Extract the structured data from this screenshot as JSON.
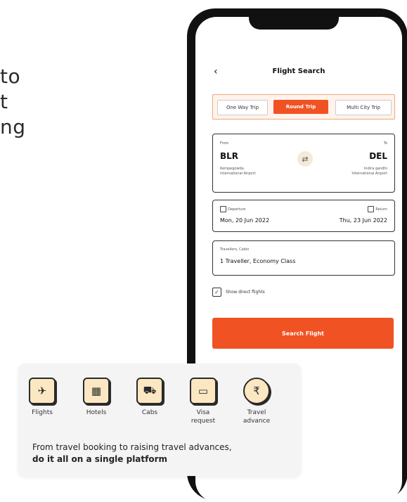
{
  "hero": {
    "line1": "to",
    "line2": "t",
    "line3": "ng"
  },
  "app": {
    "title": "Flight Search",
    "back_icon": "chevron-left-icon"
  },
  "trip_tabs": [
    {
      "label": "One Way Trip",
      "selected": false
    },
    {
      "label": "Round Trip",
      "selected": true
    },
    {
      "label": "Multi City Trip",
      "selected": false
    }
  ],
  "route": {
    "from_label": "From",
    "to_label": "To",
    "from_code": "BLR",
    "to_code": "DEL",
    "from_airport_line1": "Kempegowda",
    "from_airport_line2": "International Airport",
    "to_airport_line1": "Indira gandhi",
    "to_airport_line2": "International Airport",
    "swap_icon": "swap-icon"
  },
  "dates": {
    "departure_label": "Departure",
    "return_label": "Return",
    "departure_value": "Mon, 20 Jun 2022",
    "return_value": "Thu, 23 Jun 2022"
  },
  "traveller": {
    "label": "Travellers, Cabin",
    "value": "1 Traveller, Economy Class"
  },
  "direct_flights": {
    "label": "Show direct flights",
    "checked": true
  },
  "search_button": "Search Flight",
  "features": [
    {
      "label": "Flights",
      "icon": "airplane-icon"
    },
    {
      "label": "Hotels",
      "icon": "hotel-icon"
    },
    {
      "label": "Cabs",
      "icon": "car-icon"
    },
    {
      "label": "Visa\nrequest",
      "label_line1": "Visa",
      "label_line2": "request",
      "icon": "ticket-icon"
    },
    {
      "label": "Travel\nadvance",
      "label_line1": "Travel",
      "label_line2": "advance",
      "icon": "rupee-coin-icon"
    }
  ],
  "tagline": {
    "line1": "From travel booking to raising travel advances,",
    "line2": "do it all on a single platform"
  },
  "colors": {
    "accent": "#f05223",
    "icon_bg": "#fbe7c2",
    "card_bg": "#f4f4f4"
  }
}
